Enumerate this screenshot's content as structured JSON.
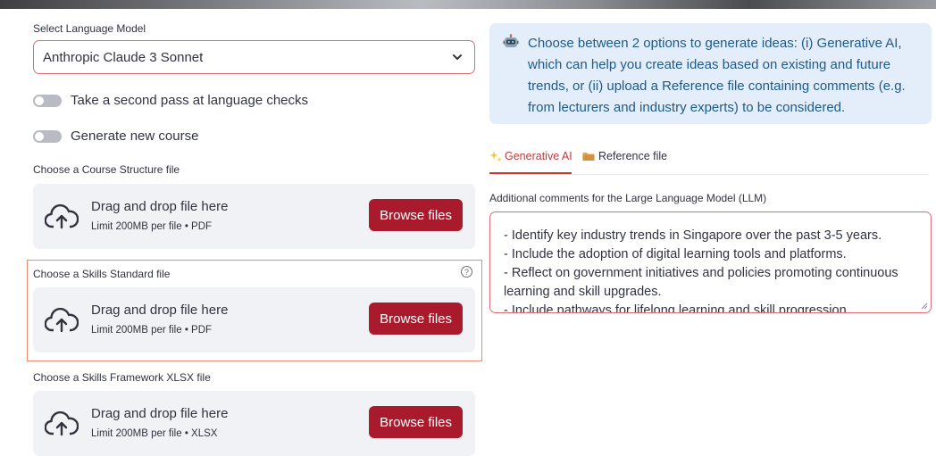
{
  "language_model": {
    "label": "Select Language Model",
    "selected": "Anthropic Claude 3 Sonnet"
  },
  "toggles": {
    "second_pass": "Take a second pass at language checks",
    "generate_course": "Generate new course"
  },
  "uploads": [
    {
      "label": "Choose a Course Structure file",
      "title": "Drag and drop file here",
      "limit": "Limit 200MB per file • PDF",
      "button": "Browse files"
    },
    {
      "label": "Choose a Skills Standard file",
      "title": "Drag and drop file here",
      "limit": "Limit 200MB per file • PDF",
      "button": "Browse files",
      "help": "?"
    },
    {
      "label": "Choose a Skills Framework XLSX file",
      "title": "Drag and drop file here",
      "limit": "Limit 200MB per file • XLSX",
      "button": "Browse files"
    }
  ],
  "info": {
    "text": "Choose between 2 options to generate ideas: (i) Generative AI, which can help you create ideas based on existing and future trends, or (ii) upload a Reference file containing comments (e.g. from lecturers and industry experts) to be considered."
  },
  "tabs": [
    {
      "label": "Generative AI",
      "icon": "sparkles-icon",
      "active": true
    },
    {
      "label": "Reference file",
      "icon": "folder-icon",
      "active": false
    }
  ],
  "comments": {
    "label": "Additional comments for the Large Language Model (LLM)",
    "lines": [
      "- Identify key industry trends in Singapore over the past 3-5 years.",
      "- Include the adoption of digital learning tools and platforms.",
      "- Reflect on government initiatives and policies promoting continuous",
      "learning and skill upgrades.",
      "- Include pathways for lifelong learning and skill progression."
    ]
  },
  "colors": {
    "accent": "#a91b2c",
    "info_bg": "#e3eefa",
    "info_text": "#1e5a8a",
    "highlight_border": "#ec8a6b"
  }
}
